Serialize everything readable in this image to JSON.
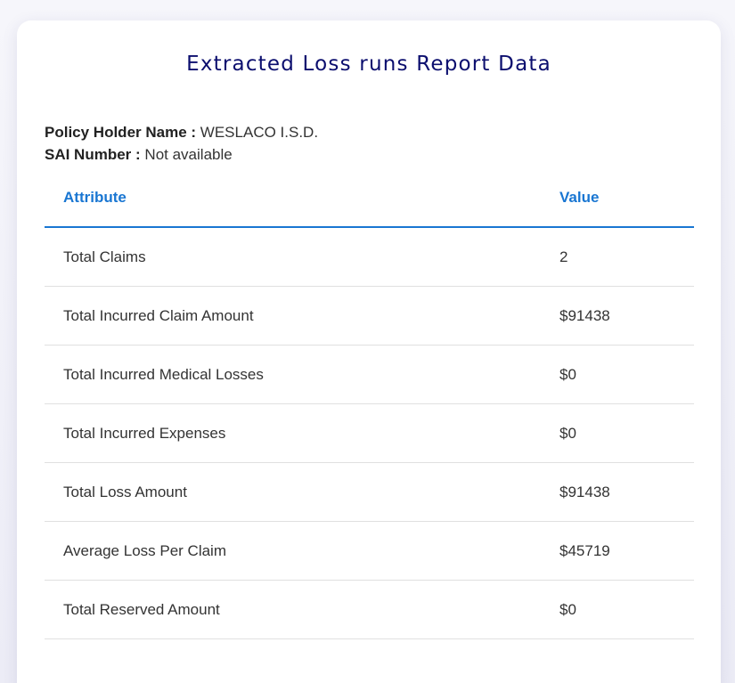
{
  "page": {
    "title": "Extracted Loss runs Report Data"
  },
  "policy": {
    "holder_label": "Policy Holder Name :",
    "holder_value": "WESLACO I.S.D.",
    "sai_label": "SAI Number :",
    "sai_value": "Not available"
  },
  "table": {
    "headers": {
      "attribute": "Attribute",
      "value": "Value"
    },
    "rows": [
      {
        "attribute": "Total Claims",
        "value": "2"
      },
      {
        "attribute": "Total Incurred Claim Amount",
        "value": "$91438"
      },
      {
        "attribute": "Total Incurred Medical Losses",
        "value": "$0"
      },
      {
        "attribute": "Total Incurred Expenses",
        "value": "$0"
      },
      {
        "attribute": "Total Loss Amount",
        "value": "$91438"
      },
      {
        "attribute": "Average Loss Per Claim",
        "value": "$45719"
      },
      {
        "attribute": "Total Reserved Amount",
        "value": "$0"
      }
    ]
  },
  "colors": {
    "title": "#0b0e6e",
    "accent": "#1976d2",
    "text": "#333333",
    "divider": "#e0e0e0"
  }
}
